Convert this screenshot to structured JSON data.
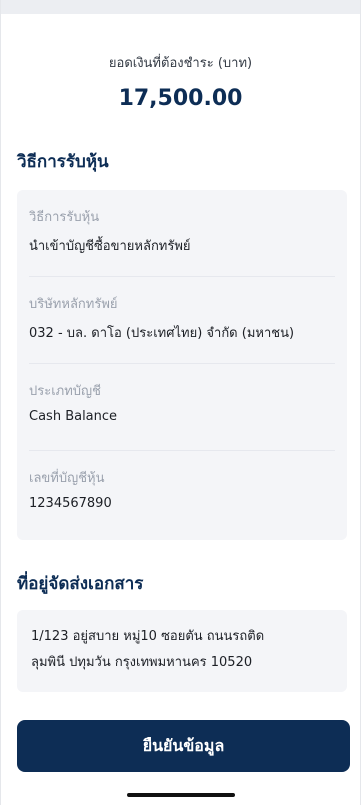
{
  "payment": {
    "label": "ยอดเงินที่ต้องชำระ (บาท)",
    "amount": "17,500.00"
  },
  "receive_section": {
    "title": "วิธีการรับหุ้น",
    "fields": [
      {
        "label": "วิธีการรับหุ้น",
        "value": "นำเข้าบัญชีซื้อขายหลักทรัพย์"
      },
      {
        "label": "บริษัทหลักทรัพย์",
        "value": "032 - บล. ดาโอ (ประเทศไทย) จำกัด (มหาชน)"
      },
      {
        "label": "ประเภทบัญชี",
        "value": "Cash Balance"
      },
      {
        "label": "เลขที่บัญชีหุ้น",
        "value": "1234567890"
      }
    ]
  },
  "address_section": {
    "title": "ที่อยู่จัดส่งเอกสาร",
    "line1": "1/123 อยู่สบาย หมู่10 ซอยตัน ถนนรถติด",
    "line2": "ลุมพินี ปทุมวัน กรุงเทพมหานคร 10520"
  },
  "confirm_button": {
    "label": "ยืนยันข้อมูล"
  },
  "colors": {
    "primary": "#0d2d55",
    "card_background": "#f4f5f8",
    "muted_label": "#9aa1ad"
  }
}
